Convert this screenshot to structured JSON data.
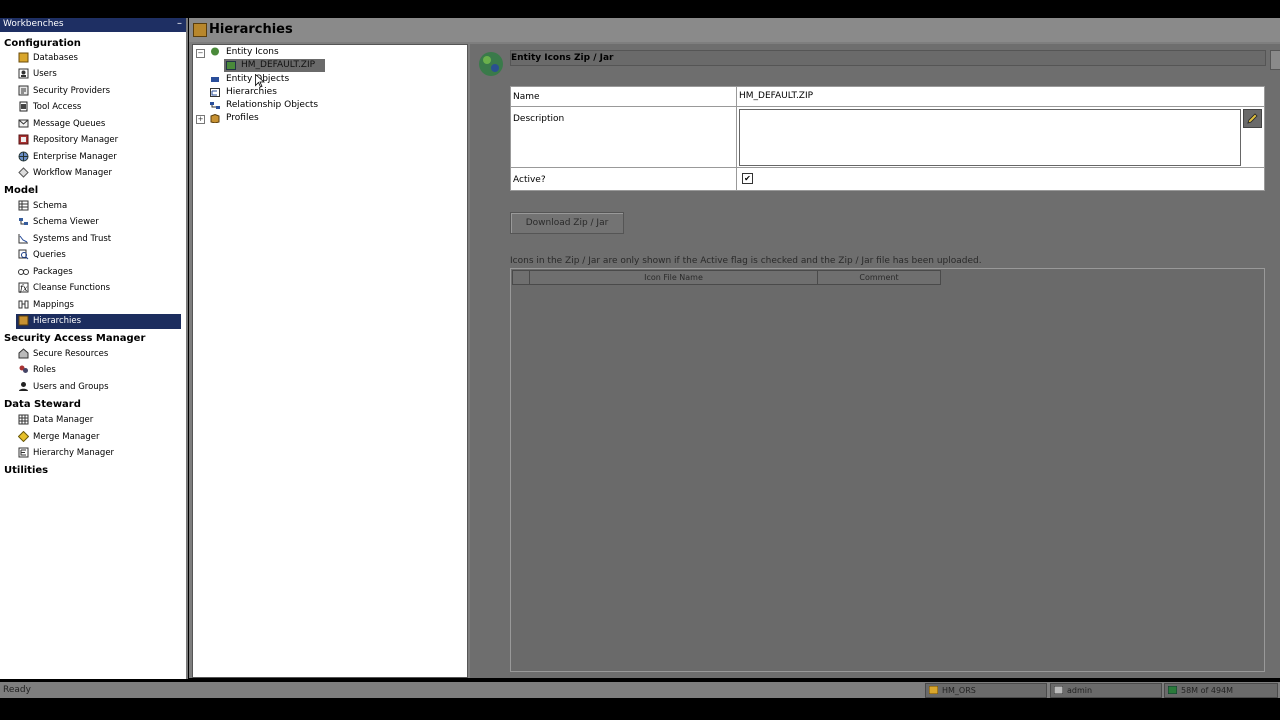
{
  "workbenches": {
    "title": "Workbenches",
    "collapse_glyph": "–",
    "sections": [
      {
        "label": "Configuration",
        "items": [
          {
            "label": "Databases",
            "icon": "database-icon"
          },
          {
            "label": "Users",
            "icon": "users-icon"
          },
          {
            "label": "Security Providers",
            "icon": "security-providers-icon"
          },
          {
            "label": "Tool Access",
            "icon": "tool-access-icon"
          },
          {
            "label": "Message Queues",
            "icon": "message-queues-icon"
          },
          {
            "label": "Repository Manager",
            "icon": "repository-manager-icon"
          },
          {
            "label": "Enterprise Manager",
            "icon": "enterprise-manager-icon"
          },
          {
            "label": "Workflow Manager",
            "icon": "workflow-manager-icon"
          }
        ]
      },
      {
        "label": "Model",
        "items": [
          {
            "label": "Schema",
            "icon": "schema-icon"
          },
          {
            "label": "Schema Viewer",
            "icon": "schema-viewer-icon"
          },
          {
            "label": "Systems and Trust",
            "icon": "systems-trust-icon"
          },
          {
            "label": "Queries",
            "icon": "queries-icon"
          },
          {
            "label": "Packages",
            "icon": "packages-icon"
          },
          {
            "label": "Cleanse Functions",
            "icon": "cleanse-functions-icon"
          },
          {
            "label": "Mappings",
            "icon": "mappings-icon"
          },
          {
            "label": "Hierarchies",
            "icon": "hierarchies-icon",
            "selected": true
          }
        ]
      },
      {
        "label": "Security Access Manager",
        "items": [
          {
            "label": "Secure Resources",
            "icon": "secure-resources-icon"
          },
          {
            "label": "Roles",
            "icon": "roles-icon"
          },
          {
            "label": "Users and Groups",
            "icon": "users-groups-icon"
          }
        ]
      },
      {
        "label": "Data Steward",
        "items": [
          {
            "label": "Data Manager",
            "icon": "data-manager-icon"
          },
          {
            "label": "Merge Manager",
            "icon": "merge-manager-icon"
          },
          {
            "label": "Hierarchy Manager",
            "icon": "hierarchy-manager-icon"
          }
        ]
      },
      {
        "label": "Utilities",
        "items": []
      }
    ]
  },
  "header": {
    "title": "Hierarchies",
    "icon": "hierarchies-icon"
  },
  "tree": {
    "nodes": [
      {
        "label": "Entity Icons",
        "toggle": "−",
        "icon": "entity-icons-icon"
      },
      {
        "label": "HM_DEFAULT.ZIP",
        "icon": "zip-file-icon",
        "selected": true
      },
      {
        "label": "Entity Objects",
        "icon": "entity-objects-icon"
      },
      {
        "label": "Hierarchies",
        "icon": "hierarchies-icon"
      },
      {
        "label": "Relationship Objects",
        "icon": "relationship-objects-icon"
      },
      {
        "label": "Profiles",
        "toggle": "+",
        "icon": "profiles-icon"
      }
    ]
  },
  "form": {
    "title": "Entity Icons Zip / Jar",
    "name_label": "Name",
    "name_value": "HM_DEFAULT.ZIP",
    "description_label": "Description",
    "description_value": "",
    "active_label": "Active?",
    "active_checked": true,
    "check_glyph": "✔",
    "edit_icon": "pencil-icon",
    "download_button": "Download Zip / Jar",
    "note": "Icons in the Zip / Jar are only shown if the Active flag is checked and the Zip / Jar file has been uploaded.",
    "grid_columns": [
      "Icon File Name",
      "Comment"
    ]
  },
  "status": {
    "ready": "Ready",
    "database": "HM_ORS",
    "user": "admin",
    "memory": "58M of 494M"
  },
  "colors": {
    "selection": "#1c2d5e",
    "panel_gray": "#7e7e7e",
    "title_bar": "#1e2f63"
  }
}
